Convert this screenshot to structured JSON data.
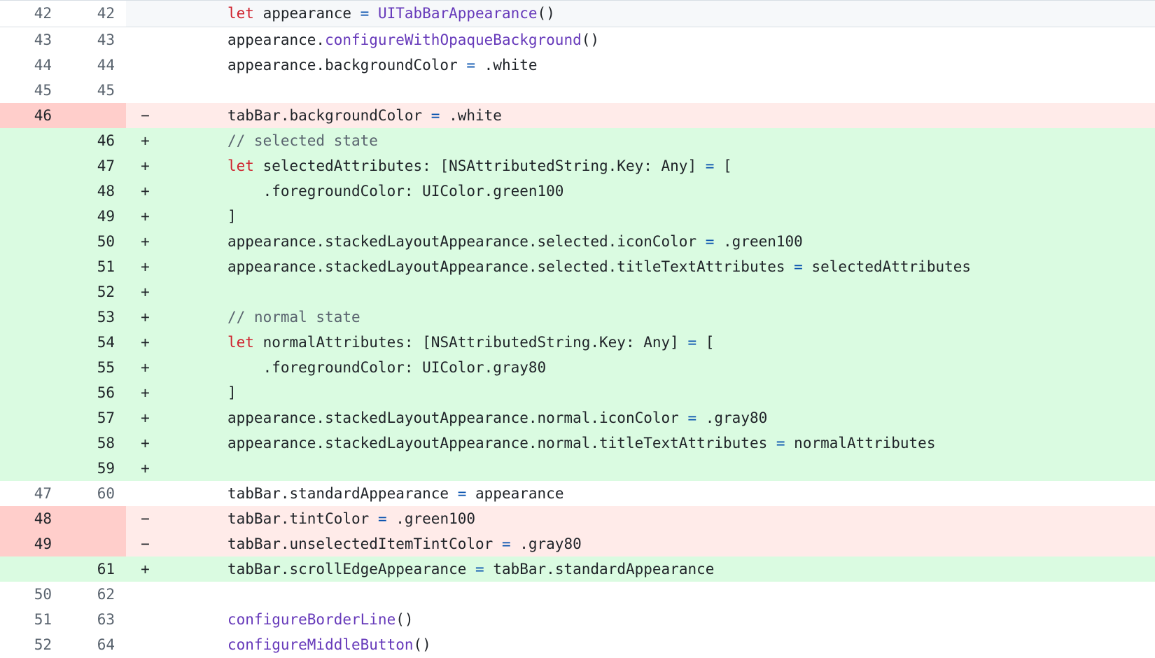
{
  "diff": {
    "rows": [
      {
        "type": "hunk",
        "old": "42",
        "new": "42",
        "marker": "",
        "tokens": [
          {
            "t": "let",
            "c": "kw"
          },
          {
            "t": " appearance ",
            "c": ""
          },
          {
            "t": "=",
            "c": "op"
          },
          {
            "t": " ",
            "c": ""
          },
          {
            "t": "UITabBarAppearance",
            "c": "fn"
          },
          {
            "t": "()",
            "c": ""
          }
        ]
      },
      {
        "type": "ctx",
        "old": "43",
        "new": "43",
        "marker": "",
        "tokens": [
          {
            "t": "appearance.",
            "c": ""
          },
          {
            "t": "configureWithOpaqueBackground",
            "c": "fn"
          },
          {
            "t": "()",
            "c": ""
          }
        ]
      },
      {
        "type": "ctx",
        "old": "44",
        "new": "44",
        "marker": "",
        "tokens": [
          {
            "t": "appearance.backgroundColor ",
            "c": ""
          },
          {
            "t": "=",
            "c": "op"
          },
          {
            "t": " .white",
            "c": ""
          }
        ]
      },
      {
        "type": "ctx",
        "old": "45",
        "new": "45",
        "marker": "",
        "tokens": []
      },
      {
        "type": "del",
        "old": "46",
        "new": "",
        "marker": "−",
        "tokens": [
          {
            "t": "tabBar.backgroundColor ",
            "c": ""
          },
          {
            "t": "=",
            "c": "op"
          },
          {
            "t": " .white",
            "c": ""
          }
        ]
      },
      {
        "type": "add",
        "old": "",
        "new": "46",
        "marker": "+",
        "tokens": [
          {
            "t": "// selected state",
            "c": "cm"
          }
        ]
      },
      {
        "type": "add",
        "old": "",
        "new": "47",
        "marker": "+",
        "tokens": [
          {
            "t": "let",
            "c": "kw"
          },
          {
            "t": " selectedAttributes: [NSAttributedString.Key: Any] ",
            "c": ""
          },
          {
            "t": "=",
            "c": "op"
          },
          {
            "t": " [",
            "c": ""
          }
        ]
      },
      {
        "type": "add",
        "old": "",
        "new": "48",
        "marker": "+",
        "tokens": [
          {
            "t": "    .foregroundColor: UIColor.green100",
            "c": ""
          }
        ]
      },
      {
        "type": "add",
        "old": "",
        "new": "49",
        "marker": "+",
        "tokens": [
          {
            "t": "]",
            "c": ""
          }
        ]
      },
      {
        "type": "add",
        "old": "",
        "new": "50",
        "marker": "+",
        "tokens": [
          {
            "t": "appearance.stackedLayoutAppearance.selected.iconColor ",
            "c": ""
          },
          {
            "t": "=",
            "c": "op"
          },
          {
            "t": " .green100",
            "c": ""
          }
        ]
      },
      {
        "type": "add",
        "old": "",
        "new": "51",
        "marker": "+",
        "tokens": [
          {
            "t": "appearance.stackedLayoutAppearance.selected.titleTextAttributes ",
            "c": ""
          },
          {
            "t": "=",
            "c": "op"
          },
          {
            "t": " selectedAttributes",
            "c": ""
          }
        ]
      },
      {
        "type": "add",
        "old": "",
        "new": "52",
        "marker": "+",
        "tokens": []
      },
      {
        "type": "add",
        "old": "",
        "new": "53",
        "marker": "+",
        "tokens": [
          {
            "t": "// normal state",
            "c": "cm"
          }
        ]
      },
      {
        "type": "add",
        "old": "",
        "new": "54",
        "marker": "+",
        "tokens": [
          {
            "t": "let",
            "c": "kw"
          },
          {
            "t": " normalAttributes: [NSAttributedString.Key: Any] ",
            "c": ""
          },
          {
            "t": "=",
            "c": "op"
          },
          {
            "t": " [",
            "c": ""
          }
        ]
      },
      {
        "type": "add",
        "old": "",
        "new": "55",
        "marker": "+",
        "tokens": [
          {
            "t": "    .foregroundColor: UIColor.gray80",
            "c": ""
          }
        ]
      },
      {
        "type": "add",
        "old": "",
        "new": "56",
        "marker": "+",
        "tokens": [
          {
            "t": "]",
            "c": ""
          }
        ]
      },
      {
        "type": "add",
        "old": "",
        "new": "57",
        "marker": "+",
        "tokens": [
          {
            "t": "appearance.stackedLayoutAppearance.normal.iconColor ",
            "c": ""
          },
          {
            "t": "=",
            "c": "op"
          },
          {
            "t": " .gray80",
            "c": ""
          }
        ]
      },
      {
        "type": "add",
        "old": "",
        "new": "58",
        "marker": "+",
        "tokens": [
          {
            "t": "appearance.stackedLayoutAppearance.normal.titleTextAttributes ",
            "c": ""
          },
          {
            "t": "=",
            "c": "op"
          },
          {
            "t": " normalAttributes",
            "c": ""
          }
        ]
      },
      {
        "type": "add",
        "old": "",
        "new": "59",
        "marker": "+",
        "tokens": []
      },
      {
        "type": "ctx",
        "old": "47",
        "new": "60",
        "marker": "",
        "tokens": [
          {
            "t": "tabBar.standardAppearance ",
            "c": ""
          },
          {
            "t": "=",
            "c": "op"
          },
          {
            "t": " appearance",
            "c": ""
          }
        ]
      },
      {
        "type": "del",
        "old": "48",
        "new": "",
        "marker": "−",
        "tokens": [
          {
            "t": "tabBar.tintColor ",
            "c": ""
          },
          {
            "t": "=",
            "c": "op"
          },
          {
            "t": " .green100",
            "c": ""
          }
        ]
      },
      {
        "type": "del",
        "old": "49",
        "new": "",
        "marker": "−",
        "tokens": [
          {
            "t": "tabBar.unselectedItemTintColor ",
            "c": ""
          },
          {
            "t": "=",
            "c": "op"
          },
          {
            "t": " .gray80",
            "c": ""
          }
        ]
      },
      {
        "type": "add",
        "old": "",
        "new": "61",
        "marker": "+",
        "tokens": [
          {
            "t": "tabBar.scrollEdgeAppearance ",
            "c": ""
          },
          {
            "t": "=",
            "c": "op"
          },
          {
            "t": " tabBar.standardAppearance",
            "c": ""
          }
        ]
      },
      {
        "type": "ctx",
        "old": "50",
        "new": "62",
        "marker": "",
        "tokens": []
      },
      {
        "type": "ctx",
        "old": "51",
        "new": "63",
        "marker": "",
        "tokens": [
          {
            "t": "configureBorderLine",
            "c": "fn"
          },
          {
            "t": "()",
            "c": ""
          }
        ]
      },
      {
        "type": "ctx",
        "old": "52",
        "new": "64",
        "marker": "",
        "tokens": [
          {
            "t": "configureMiddleButton",
            "c": "fn"
          },
          {
            "t": "()",
            "c": ""
          }
        ]
      }
    ]
  },
  "colors": {
    "addition_bg": "#dafbe1",
    "deletion_bg": "#ffebe9",
    "deletion_gutter": "#ffcecb",
    "keyword": "#cf222e",
    "function": "#6639ba",
    "operator": "#0550ae",
    "comment": "#59636e"
  }
}
